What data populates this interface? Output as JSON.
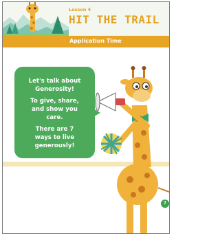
{
  "header": {
    "lesson": "Lesson 4",
    "title": "HIT THE TRAIL",
    "section": "Application Time"
  },
  "bubble": {
    "lines_1": [
      "Let's talk about",
      "Generosity!"
    ],
    "lines_2": [
      "To give, share,",
      "and show you",
      "care."
    ],
    "lines_3": [
      "There are 7",
      "ways to live",
      "generously!"
    ]
  },
  "page_number": "7",
  "colors": {
    "accent": "#e8a524",
    "bubble": "#4daa5a",
    "page_badge": "#39a24a"
  },
  "icons": [
    "giraffe-illustration",
    "megaphone-icon",
    "pom-pom-icon",
    "mountains-illustration"
  ]
}
